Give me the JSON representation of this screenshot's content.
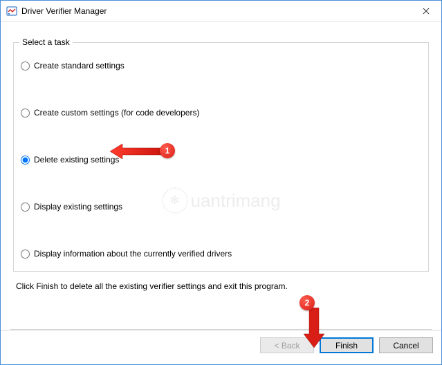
{
  "window": {
    "title": "Driver Verifier Manager"
  },
  "group": {
    "legend": "Select a task",
    "options": [
      {
        "label": "Create standard settings",
        "selected": false
      },
      {
        "label": "Create custom settings (for code developers)",
        "selected": false
      },
      {
        "label": "Delete existing settings",
        "selected": true
      },
      {
        "label": "Display existing settings",
        "selected": false
      },
      {
        "label": "Display information about the currently verified drivers",
        "selected": false
      }
    ]
  },
  "help_text": "Click Finish to delete all the existing verifier settings and exit this program.",
  "buttons": {
    "back": "< Back",
    "finish": "Finish",
    "cancel": "Cancel"
  },
  "annotations": {
    "badge1": "1",
    "badge2": "2"
  },
  "watermark": "uantrimang"
}
